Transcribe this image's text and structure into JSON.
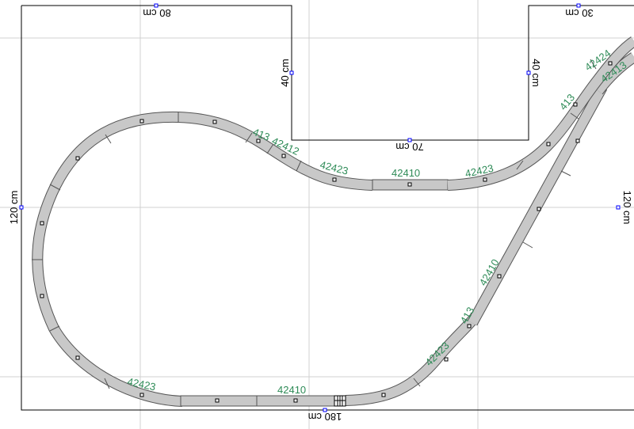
{
  "dimensions": {
    "top_left": "80 cm",
    "top_right": "30 cm",
    "notch_left": "40 cm",
    "notch_right": "40 cm",
    "notch_bottom": "70 cm",
    "left": "120 cm",
    "right": "120 cm",
    "bottom": "180 cm"
  },
  "track_labels": {
    "a": "413",
    "b": "42412",
    "c": "42423",
    "d": "42410",
    "e": "42423",
    "f": "413",
    "g": "42424",
    "h": "42413",
    "i": "42410",
    "j": "413",
    "k": "42423",
    "l": "42423",
    "m": "42410"
  },
  "colors": {
    "track_fill": "#c8c8c8",
    "track_stroke": "#555555",
    "label": "#2e8b57",
    "grid": "#d0d0d0",
    "border": "#000000",
    "handle": "#0000ff"
  }
}
